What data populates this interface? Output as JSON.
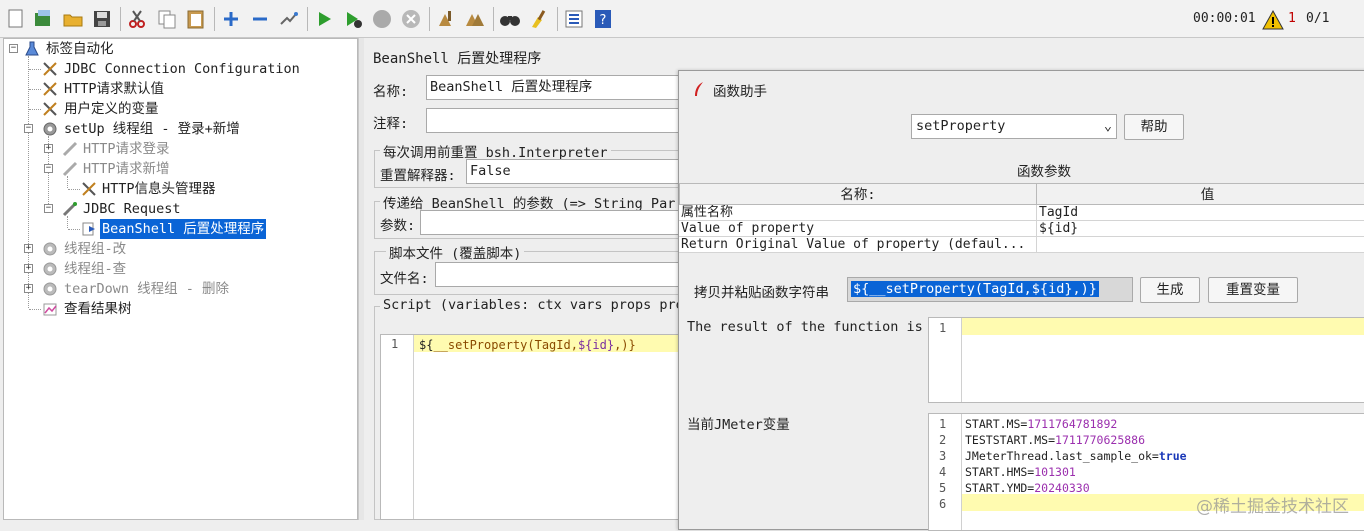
{
  "toolbar": {
    "timer": "00:00:01",
    "warnings": "1",
    "threads": "0/1"
  },
  "tree": {
    "items": [
      {
        "label": "标签自动化",
        "icon": "test-plan-icon",
        "state": "normal"
      },
      {
        "label": "JDBC Connection Configuration",
        "icon": "config-icon",
        "state": "normal"
      },
      {
        "label": "HTTP请求默认值",
        "icon": "config-icon",
        "state": "normal"
      },
      {
        "label": "用户定义的变量",
        "icon": "config-icon",
        "state": "normal"
      },
      {
        "label": "setUp 线程组 - 登录+新增",
        "icon": "thread-group-icon",
        "state": "normal"
      },
      {
        "label": "HTTP请求登录",
        "icon": "sampler-icon",
        "state": "disabled"
      },
      {
        "label": "HTTP请求新增",
        "icon": "sampler-icon",
        "state": "disabled"
      },
      {
        "label": "HTTP信息头管理器",
        "icon": "config-icon",
        "state": "normal"
      },
      {
        "label": "JDBC Request",
        "icon": "sampler-icon",
        "state": "normal"
      },
      {
        "label": "BeanShell 后置处理程序",
        "icon": "postprocessor-icon",
        "state": "selected"
      },
      {
        "label": "线程组-改",
        "icon": "thread-group-icon",
        "state": "disabled"
      },
      {
        "label": "线程组-查",
        "icon": "thread-group-icon",
        "state": "disabled"
      },
      {
        "label": "tearDown 线程组 - 删除",
        "icon": "thread-group-icon",
        "state": "disabled"
      },
      {
        "label": "查看结果树",
        "icon": "listener-icon",
        "state": "normal"
      }
    ]
  },
  "editor": {
    "title": "BeanShell 后置处理程序",
    "name_label": "名称:",
    "name_value": "BeanShell 后置处理程序",
    "comment_label": "注释:",
    "reset_group": "每次调用前重置 bsh.Interpreter",
    "reset_label": "重置解释器:",
    "reset_value": "False",
    "params_group": "传递给 BeanShell 的参数 (=> String Par",
    "params_label": "参数:",
    "file_group": "脚本文件 (覆盖脚本)",
    "file_label": "文件名:",
    "script_group": "Script (variables: ctx vars props pre",
    "code_line_number": "1",
    "code": {
      "prefix": "${",
      "fn": "__setProperty(TagId,",
      "var": "${id}",
      "suffix": ",)}"
    }
  },
  "dialog": {
    "title": "函数助手",
    "function_select": "setProperty",
    "help_button": "帮助",
    "params_header": "函数参数",
    "table": {
      "columns": [
        "名称:",
        "值"
      ],
      "rows": [
        [
          "属性名称",
          "TagId"
        ],
        [
          "Value of property",
          "${id}"
        ],
        [
          "Return Original Value of property (defaul...",
          ""
        ]
      ]
    },
    "copy_label": "拷贝并粘贴函数字符串",
    "copy_value": "${__setProperty(TagId,${id},)}",
    "generate_button": "生成",
    "reset_vars_button": "重置变量",
    "result_label": "The result of the function is",
    "result_line_number": "1",
    "vars_label": "当前JMeter变量",
    "vars": [
      {
        "n": "1",
        "key": "START.MS=",
        "val": "1711764781892"
      },
      {
        "n": "2",
        "key": "TESTSTART.MS=",
        "val": "1711770625886"
      },
      {
        "n": "3",
        "key": "JMeterThread.last_sample_ok=",
        "val": "true"
      },
      {
        "n": "4",
        "key": "START.HMS=",
        "val": "101301"
      },
      {
        "n": "5",
        "key": "START.YMD=",
        "val": "20240330"
      },
      {
        "n": "6",
        "key": "",
        "val": ""
      }
    ]
  },
  "watermark": "@稀土掘金技术社区",
  "colors": {
    "selection": "#0a64d6",
    "highlight_line": "#fffbb0",
    "run_green": "#2e9e2e",
    "warning_red": "#c00000"
  }
}
